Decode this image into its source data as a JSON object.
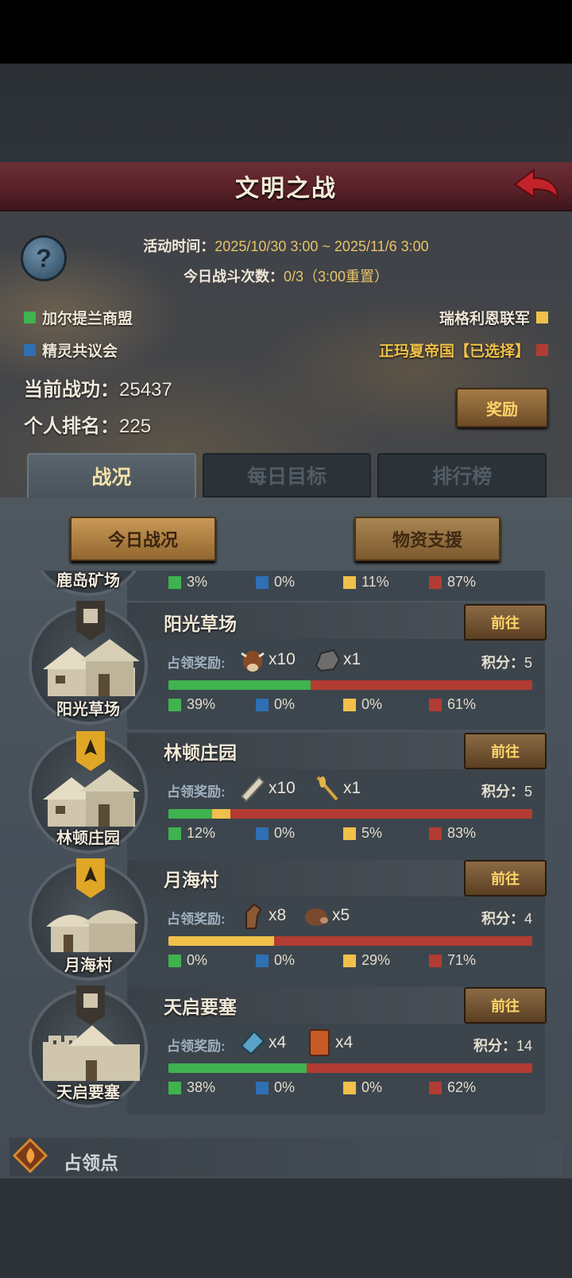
{
  "header": {
    "title": "文明之战"
  },
  "event": {
    "time_label": "活动时间：",
    "time_value": "2025/10/30 3:00 ~ 2025/11/6 3:00",
    "battles_label": "今日战斗次数：",
    "battles_value": "0/3（3:00重置）"
  },
  "alliances": [
    {
      "name": "加尔提兰商盟",
      "color": "#3fb34f"
    },
    {
      "name": "精灵共议会",
      "color": "#2f6fb3"
    },
    {
      "name": "瑞格利恩联军",
      "color": "#f0c04a"
    },
    {
      "name": "正玛夏帝国【已选择】",
      "color": "#b23c33"
    }
  ],
  "stats": {
    "merit_label": "当前战功：",
    "merit_value": "25437",
    "rank_label": "个人排名：",
    "rank_value": "225",
    "reward_button": "奖励"
  },
  "tabs": [
    "战况",
    "每日目标",
    "排行榜"
  ],
  "sub_buttons": [
    "今日战况",
    "物资支援"
  ],
  "reward_label": "占领奖励:",
  "score_label": "积分：",
  "goto_label": "前往",
  "locations": [
    {
      "name": "鹿岛矿场",
      "percents": [
        "3%",
        "0%",
        "11%",
        "87%"
      ],
      "shares": [
        0.03,
        0.0,
        0.11,
        0.87
      ]
    },
    {
      "name": "阳光草场",
      "items": [
        {
          "icon": "cow-icon",
          "qty": "x10"
        },
        {
          "icon": "ore-icon",
          "qty": "x1"
        }
      ],
      "score": "5",
      "percents": [
        "39%",
        "0%",
        "0%",
        "61%"
      ],
      "shares": [
        0.39,
        0.0,
        0.0,
        0.61
      ],
      "banner": "dark"
    },
    {
      "name": "林顿庄园",
      "items": [
        {
          "icon": "scroll-icon",
          "qty": "x10"
        },
        {
          "icon": "wheat-icon",
          "qty": "x1"
        }
      ],
      "score": "5",
      "percents": [
        "12%",
        "0%",
        "5%",
        "83%"
      ],
      "shares": [
        0.12,
        0.0,
        0.05,
        0.83
      ],
      "banner": "gold"
    },
    {
      "name": "月海村",
      "items": [
        {
          "icon": "horse-icon",
          "qty": "x8"
        },
        {
          "icon": "boar-icon",
          "qty": "x5"
        }
      ],
      "score": "4",
      "percents": [
        "0%",
        "0%",
        "29%",
        "71%"
      ],
      "shares": [
        0.0,
        0.0,
        0.29,
        0.71
      ],
      "banner": "gold"
    },
    {
      "name": "天启要塞",
      "items": [
        {
          "icon": "map-icon",
          "qty": "x4"
        },
        {
          "icon": "wood-plank-icon",
          "qty": "x4"
        }
      ],
      "score": "14",
      "percents": [
        "38%",
        "0%",
        "0%",
        "62%"
      ],
      "shares": [
        0.38,
        0.0,
        0.0,
        0.62
      ],
      "banner": "dark"
    }
  ],
  "footer": {
    "label": "占领点"
  }
}
